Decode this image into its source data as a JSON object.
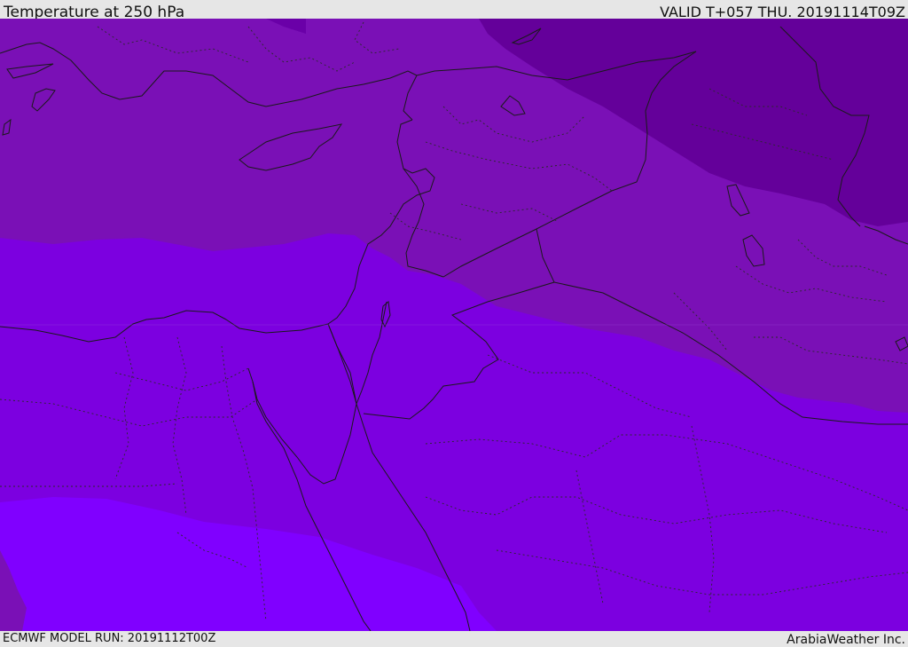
{
  "header": {
    "title": "Temperature at 250 hPa",
    "valid_time": "VALID T+057 THU. 20191114T09Z"
  },
  "footer": {
    "model_run": "ECMWF MODEL RUN: 20191112T00Z",
    "credit": "ArabiaWeather Inc."
  },
  "colors": {
    "band_darkest": "#64009a",
    "band_dark": "#7a10b6",
    "band_mid": "#7c00e0",
    "band_light": "#8000ff",
    "coast_line": "#1a1a1a"
  }
}
